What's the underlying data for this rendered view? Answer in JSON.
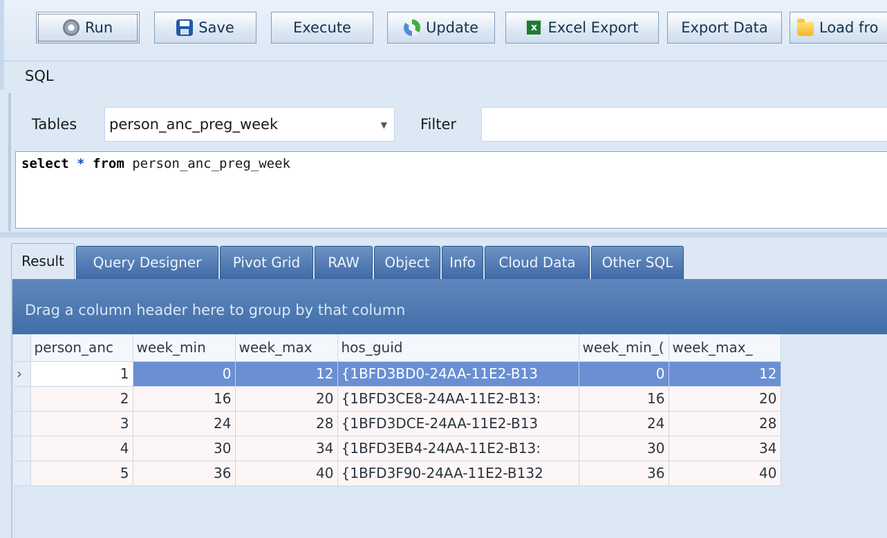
{
  "toolbar": {
    "buttons": [
      {
        "label": "Run",
        "icon": "gear-icon"
      },
      {
        "label": "Save",
        "icon": "save-icon"
      },
      {
        "label": "Execute"
      },
      {
        "label": "Update",
        "icon": "update-icon"
      },
      {
        "label": "Excel Export",
        "icon": "excel-icon"
      },
      {
        "label": "Export Data"
      },
      {
        "label": "Load fro",
        "icon": "folder-icon"
      }
    ]
  },
  "sql_section": {
    "title": "SQL",
    "tables_label": "Tables",
    "tables_value": "person_anc_preg_week",
    "filter_label": "Filter",
    "filter_value": "",
    "query": {
      "kw1": "select",
      "star": "*",
      "kw2": "from",
      "table": "person_anc_preg_week"
    }
  },
  "tabs": [
    "Result",
    "Query Designer",
    "Pivot Grid",
    "RAW",
    "Object",
    "Info",
    "Cloud Data",
    "Other SQL"
  ],
  "grid": {
    "group_hint": "Drag a column header here to group by that column",
    "columns": [
      "person_anc",
      "week_min",
      "week_max",
      "hos_guid",
      "week_min_(",
      "week_max_"
    ],
    "rows": [
      [
        "1",
        "0",
        "12",
        "{1BFD3BD0-24AA-11E2-B13",
        "0",
        "12"
      ],
      [
        "2",
        "16",
        "20",
        "{1BFD3CE8-24AA-11E2-B13:",
        "16",
        "20"
      ],
      [
        "3",
        "24",
        "28",
        "{1BFD3DCE-24AA-11E2-B13",
        "24",
        "28"
      ],
      [
        "4",
        "30",
        "34",
        "{1BFD3EB4-24AA-11E2-B13:",
        "30",
        "34"
      ],
      [
        "5",
        "36",
        "40",
        "{1BFD3F90-24AA-11E2-B132",
        "36",
        "40"
      ]
    ],
    "row_indicator": "›"
  }
}
